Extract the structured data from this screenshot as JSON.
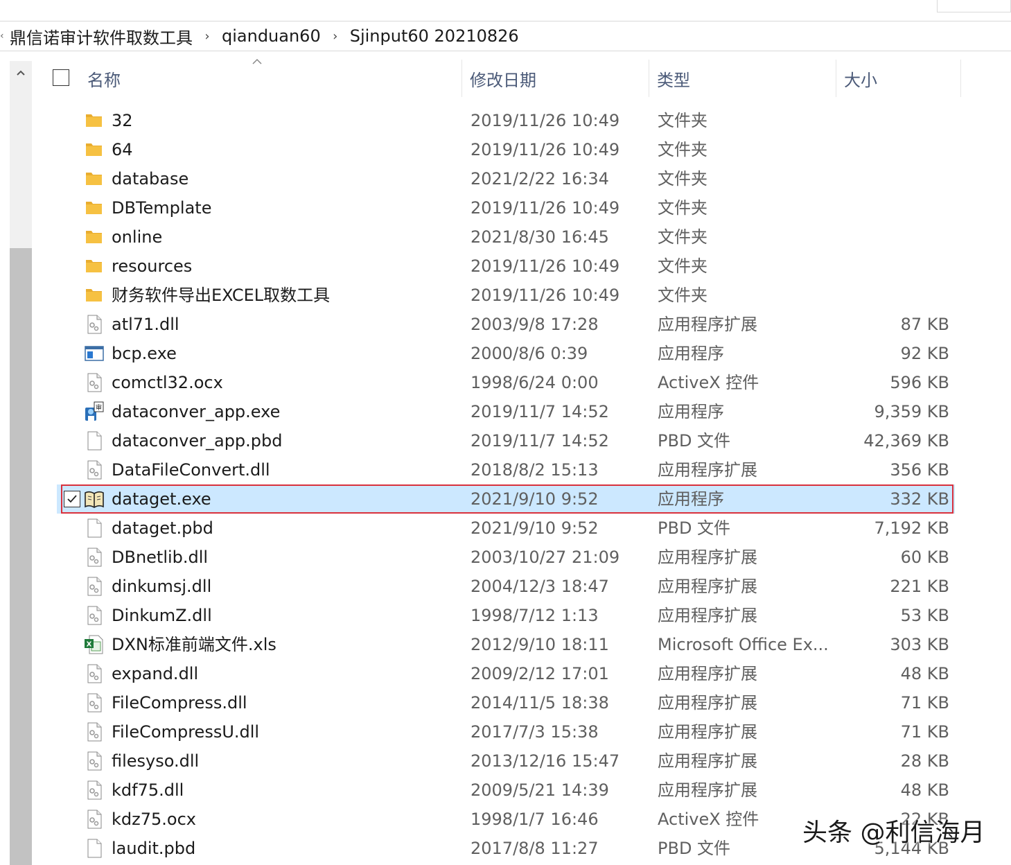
{
  "breadcrumb": [
    "鼎信诺审计软件取数工具",
    "qianduan60",
    "Sjinput60 20210826"
  ],
  "columns": {
    "name": "名称",
    "date": "修改日期",
    "type": "类型",
    "size": "大小"
  },
  "files": [
    {
      "name": "32",
      "date": "2019/11/26 10:49",
      "type": "文件夹",
      "size": "",
      "icon": "folder-icon"
    },
    {
      "name": "64",
      "date": "2019/11/26 10:49",
      "type": "文件夹",
      "size": "",
      "icon": "folder-icon"
    },
    {
      "name": "database",
      "date": "2021/2/22 16:34",
      "type": "文件夹",
      "size": "",
      "icon": "folder-icon"
    },
    {
      "name": "DBTemplate",
      "date": "2019/11/26 10:49",
      "type": "文件夹",
      "size": "",
      "icon": "folder-icon"
    },
    {
      "name": "online",
      "date": "2021/8/30 16:45",
      "type": "文件夹",
      "size": "",
      "icon": "folder-icon"
    },
    {
      "name": "resources",
      "date": "2019/11/26 10:49",
      "type": "文件夹",
      "size": "",
      "icon": "folder-icon"
    },
    {
      "name": "财务软件导出EXCEL取数工具",
      "date": "2019/11/26 10:49",
      "type": "文件夹",
      "size": "",
      "icon": "folder-icon"
    },
    {
      "name": "atl71.dll",
      "date": "2003/9/8 17:28",
      "type": "应用程序扩展",
      "size": "87 KB",
      "icon": "dll-icon"
    },
    {
      "name": "bcp.exe",
      "date": "2000/8/6 0:39",
      "type": "应用程序",
      "size": "92 KB",
      "icon": "exe-window-icon"
    },
    {
      "name": "comctl32.ocx",
      "date": "1998/6/24 0:00",
      "type": "ActiveX 控件",
      "size": "596 KB",
      "icon": "dll-icon"
    },
    {
      "name": "dataconver_app.exe",
      "date": "2019/11/7 14:52",
      "type": "应用程序",
      "size": "9,359 KB",
      "icon": "dataconver-app-icon"
    },
    {
      "name": "dataconver_app.pbd",
      "date": "2019/11/7 14:52",
      "type": "PBD 文件",
      "size": "42,369 KB",
      "icon": "blank-file-icon"
    },
    {
      "name": "DataFileConvert.dll",
      "date": "2018/8/2 15:13",
      "type": "应用程序扩展",
      "size": "356 KB",
      "icon": "dll-icon"
    },
    {
      "name": "dataget.exe",
      "date": "2021/9/10 9:52",
      "type": "应用程序",
      "size": "332 KB",
      "icon": "book-app-icon",
      "selected": true
    },
    {
      "name": "dataget.pbd",
      "date": "2021/9/10 9:52",
      "type": "PBD 文件",
      "size": "7,192 KB",
      "icon": "blank-file-icon"
    },
    {
      "name": "DBnetlib.dll",
      "date": "2003/10/27 21:09",
      "type": "应用程序扩展",
      "size": "60 KB",
      "icon": "dll-icon"
    },
    {
      "name": "dinkumsj.dll",
      "date": "2004/12/3 18:47",
      "type": "应用程序扩展",
      "size": "221 KB",
      "icon": "dll-icon"
    },
    {
      "name": "DinkumZ.dll",
      "date": "1998/7/12 1:13",
      "type": "应用程序扩展",
      "size": "53 KB",
      "icon": "dll-icon"
    },
    {
      "name": "DXN标准前端文件.xls",
      "date": "2012/9/10 18:11",
      "type": "Microsoft Office Ex...",
      "size": "303 KB",
      "icon": "excel-file-icon"
    },
    {
      "name": "expand.dll",
      "date": "2009/2/12 17:01",
      "type": "应用程序扩展",
      "size": "48 KB",
      "icon": "dll-icon"
    },
    {
      "name": "FileCompress.dll",
      "date": "2014/11/5 18:38",
      "type": "应用程序扩展",
      "size": "71 KB",
      "icon": "dll-icon"
    },
    {
      "name": "FileCompressU.dll",
      "date": "2017/7/3 15:38",
      "type": "应用程序扩展",
      "size": "71 KB",
      "icon": "dll-icon"
    },
    {
      "name": "filesyso.dll",
      "date": "2013/12/16 15:47",
      "type": "应用程序扩展",
      "size": "28 KB",
      "icon": "dll-icon"
    },
    {
      "name": "kdf75.dll",
      "date": "2009/5/21 14:39",
      "type": "应用程序扩展",
      "size": "48 KB",
      "icon": "dll-icon"
    },
    {
      "name": "kdz75.ocx",
      "date": "1998/1/7 16:46",
      "type": "ActiveX 控件",
      "size": "22 KB",
      "icon": "dll-icon"
    },
    {
      "name": "laudit.pbd",
      "date": "2017/8/8 11:27",
      "type": "PBD 文件",
      "size": "5,144 KB",
      "icon": "blank-file-icon"
    }
  ],
  "watermark": "头条 @利信海月",
  "colors": {
    "selection": "#cce8ff",
    "highlight_border": "#d9303b",
    "folder": "#f6c142",
    "header_text": "#4b5a78"
  }
}
